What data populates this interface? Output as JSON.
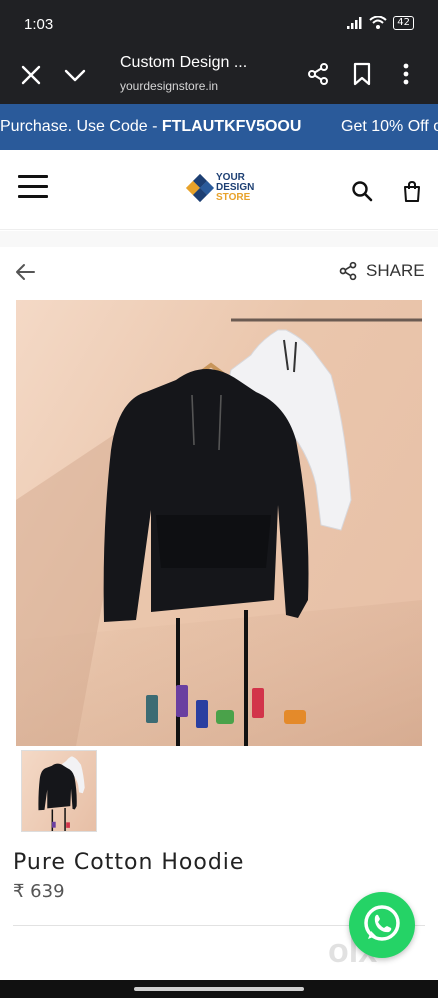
{
  "status_bar": {
    "time": "1:03",
    "battery": "42"
  },
  "browser": {
    "title": "Custom Design ...",
    "url": "yourdesignstore.in",
    "icons": [
      "close-icon",
      "chevron-down-icon",
      "share-icon",
      "bookmark-icon",
      "more-vert-icon"
    ]
  },
  "promo": {
    "text_prefix": "Purchase. Use Code - ",
    "code": "FTLAUTKFV5OOU",
    "text_next": "Get 10% Off o"
  },
  "header": {
    "logo_line1": "YOUR",
    "logo_line2": "DESIGN",
    "logo_line3": "STORE",
    "icons": [
      "menu-icon",
      "search-icon",
      "shopping-bag-icon"
    ]
  },
  "product_nav": {
    "share_label": "SHARE"
  },
  "product": {
    "name": "Pure Cotton Hoodie",
    "price": "₹ 639"
  },
  "colors": {
    "promo_bg": "#2a5a9a",
    "browser_bg": "#202124",
    "whatsapp": "#25d366",
    "logo_blue": "#1d3f73",
    "logo_orange": "#e8a22a"
  },
  "watermark": "olx"
}
